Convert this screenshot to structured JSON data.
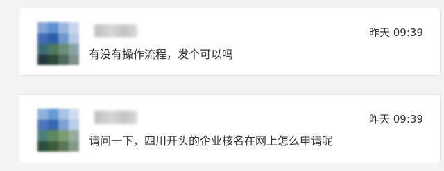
{
  "messages": [
    {
      "time": "昨天 09:39",
      "text": "有没有操作流程，发个可以吗",
      "avatar_colors": [
        "#7fa6d6",
        "#5d8fd0",
        "#9bb6dc",
        "#c8d6ea",
        "#3f6db5",
        "#2c5ea8",
        "#6f97cf",
        "#b7c9e4",
        "#3b6a78",
        "#4c7a5e",
        "#6a8e78",
        "#8aa3a9",
        "#243c3f",
        "#2f4a36",
        "#4f6a5a",
        "#7d8f8c"
      ]
    },
    {
      "time": "昨天 09:39",
      "text": "请问一下，四川开头的企业核名在网上怎么申请呢",
      "avatar_colors": [
        "#8fb2dc",
        "#6a9ad4",
        "#a9c1e2",
        "#d0dcee",
        "#4a78bb",
        "#3767ad",
        "#7ca1d3",
        "#bccde6",
        "#4f7f7a",
        "#5d8a5a",
        "#7c9c74",
        "#94ab9e",
        "#2d4d3e",
        "#3d5c3a",
        "#5b7658",
        "#87998a"
      ]
    }
  ],
  "colors": {
    "background": "#f3f3f3",
    "card": "#ffffff",
    "text": "#333333"
  }
}
